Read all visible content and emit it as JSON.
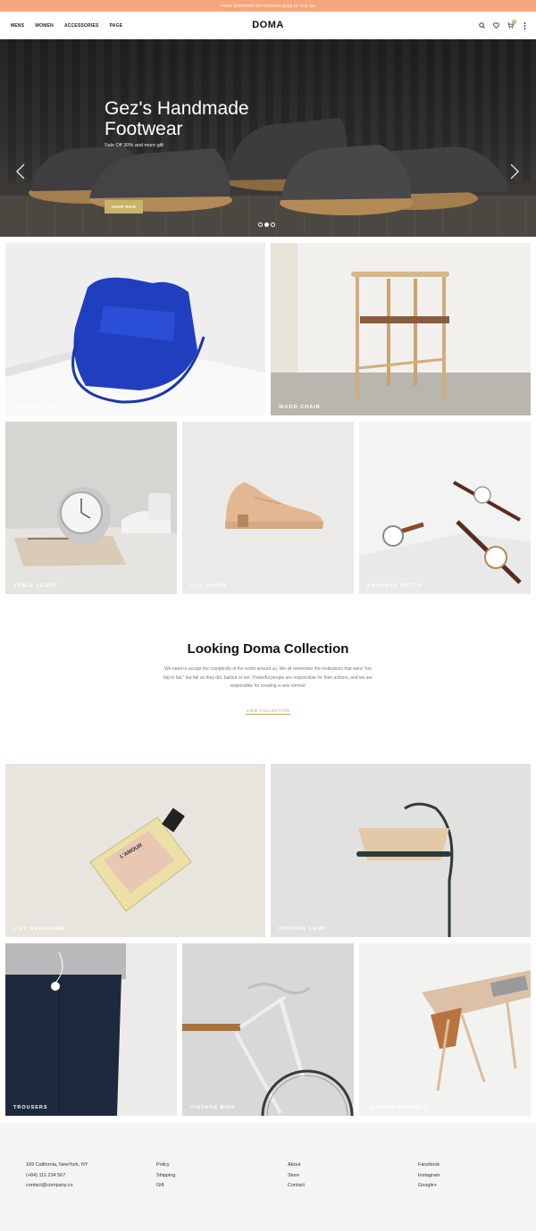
{
  "topbar": {
    "text": "FREE SHIPPING ON ORDERS $15& IN THE US"
  },
  "nav": {
    "links": [
      "MENS",
      "WOMEN",
      "ACCESSORIES",
      "PAGE"
    ],
    "logo": "DOMA",
    "cart_count": "0",
    "icons": [
      "search-icon",
      "heart-icon",
      "cart-icon",
      "more-icon"
    ]
  },
  "hero": {
    "title": "Gez's Handmade Footwear",
    "subtitle": "Sale Off 30% and more gift",
    "button": "SHOP NOW",
    "slides_total": 3,
    "active_slide": 2
  },
  "tiles_top": [
    {
      "label": "MODERN BAG"
    },
    {
      "label": "WOOD CHAIR"
    },
    {
      "label": "TABLE CLOCK"
    },
    {
      "label": "OLD SHOES"
    },
    {
      "label": "BAUHAUS WATCH"
    }
  ],
  "collection": {
    "title": "Looking Doma Collection",
    "body": "We need to accept the complexity of the world around us. We all remember the institutions that were \"too big to fail,\" but fail us they did, bailout or not. Powerful people are responsible for their actions, and we are responsible for creating a new normal.",
    "link": "VIEW COLLECTION"
  },
  "tiles_bottom": [
    {
      "label": "L'AU PERFUNME"
    },
    {
      "label": "WOODEN LAMP"
    },
    {
      "label": "TROUSERS"
    },
    {
      "label": "VINTAGE BIKE"
    },
    {
      "label": "LEATHER BASKETS"
    }
  ],
  "perfume_label": "L'AMOUR",
  "footer": {
    "contact": [
      "169 California, NewYork, NY",
      "(+84) 111 234 567",
      "contact@company.co"
    ],
    "col2": [
      "Policy",
      "Shipping",
      "Gift"
    ],
    "col3": [
      "About",
      "Store",
      "Contact"
    ],
    "social": [
      "Facebook",
      "Instagram",
      "Google+"
    ]
  },
  "colors": {
    "accent": "#c8b36a",
    "topbar": "#f5a67c",
    "footer_bg": "#f4f4f4"
  }
}
